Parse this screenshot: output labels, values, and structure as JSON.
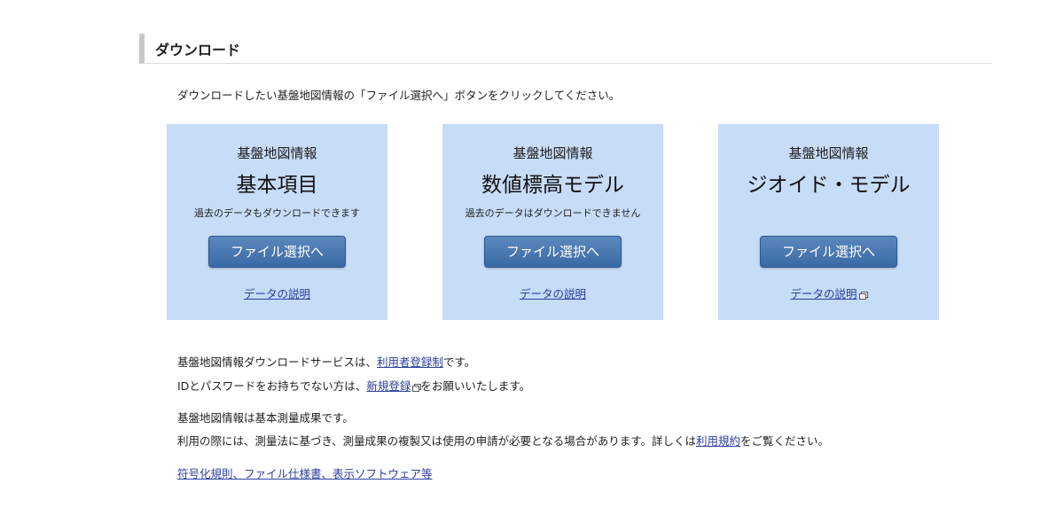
{
  "section": {
    "title": "ダウンロード"
  },
  "intro": "ダウンロードしたい基盤地図情報の「ファイル選択へ」ボタンをクリックしてください。",
  "cards": [
    {
      "subtitle": "基盤地図情報",
      "title": "基本項目",
      "note": "過去のデータもダウンロードできます",
      "button": "ファイル選択へ",
      "link": "データの説明",
      "external": false
    },
    {
      "subtitle": "基盤地図情報",
      "title": "数値標高モデル",
      "note": "過去のデータはダウンロードできません",
      "button": "ファイル選択へ",
      "link": "データの説明",
      "external": false
    },
    {
      "subtitle": "基盤地図情報",
      "title": "ジオイド・モデル",
      "note": "",
      "button": "ファイル選択へ",
      "link": "データの説明",
      "external": true
    }
  ],
  "info": {
    "line1_prefix": "基盤地図情報ダウンロードサービスは、",
    "line1_link": "利用者登録制",
    "line1_suffix": "です。",
    "line2_prefix": "IDとパスワードをお持ちでない方は、",
    "line2_link": "新規登録",
    "line2_suffix": "をお願いいたします。",
    "line3": "基盤地図情報は基本測量成果です。",
    "line4_prefix": "利用の際には、測量法に基づき、測量成果の複製又は使用の申請が必要となる場合があります。詳しくは",
    "line4_link": "利用規約",
    "line4_suffix": "をご覧ください。",
    "bottom_link": "符号化規則、ファイル仕様書、表示ソフトウェア等"
  },
  "colors": {
    "card_background": "#c6dcf7",
    "button": "#4677b2",
    "link": "#2b3f9c"
  }
}
